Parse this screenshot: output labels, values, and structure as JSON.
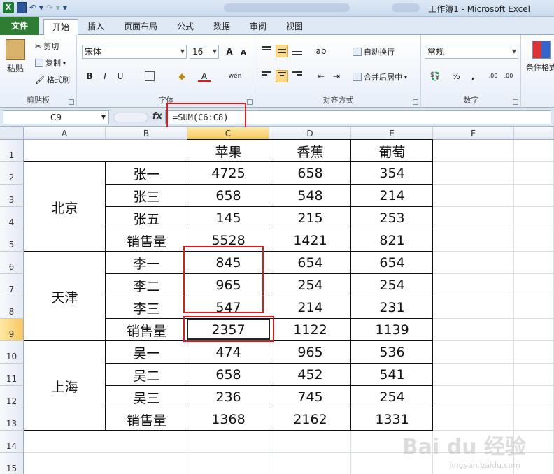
{
  "title_bar": {
    "window_title": "工作簿1 - Microsoft Excel",
    "app_icon_letter": "X"
  },
  "ribbon_tabs": [
    "文件",
    "开始",
    "插入",
    "页面布局",
    "公式",
    "数据",
    "审阅",
    "视图"
  ],
  "clipboard": {
    "paste": "粘贴",
    "cut": "剪切",
    "copy": "复制",
    "format_painter": "格式刷",
    "label": "剪贴板"
  },
  "font": {
    "name": "宋体",
    "size": "16",
    "bold": "B",
    "italic": "I",
    "underline": "U",
    "grow": "A",
    "shrink": "A",
    "color_letter": "A",
    "phonetic": "wén",
    "label": "字体"
  },
  "alignment": {
    "wrap_text": "自动换行",
    "merge_center": "合并后居中",
    "label": "对齐方式"
  },
  "number": {
    "format": "常规",
    "percent": "%",
    "comma": ",",
    "inc_dec": ".00",
    "label": "数字"
  },
  "styles": {
    "conditional_format": "条件格式"
  },
  "formula_bar": {
    "name_box": "C9",
    "fx": "fx",
    "formula": "=SUM(C6:C8)"
  },
  "columns": [
    "A",
    "B",
    "C",
    "D",
    "E",
    "F"
  ],
  "rows": [
    "1",
    "2",
    "3",
    "4",
    "5",
    "6",
    "7",
    "8",
    "9",
    "10",
    "11",
    "12",
    "13",
    "14",
    "15"
  ],
  "table": {
    "headers": [
      "苹果",
      "香蕉",
      "葡萄"
    ],
    "groups": [
      {
        "city": "北京",
        "rows": [
          {
            "name": "张一",
            "values": [
              "4725",
              "658",
              "354"
            ]
          },
          {
            "name": "张三",
            "values": [
              "658",
              "548",
              "214"
            ]
          },
          {
            "name": "张五",
            "values": [
              "145",
              "215",
              "253"
            ]
          },
          {
            "name": "销售量",
            "values": [
              "5528",
              "1421",
              "821"
            ]
          }
        ]
      },
      {
        "city": "天津",
        "rows": [
          {
            "name": "李一",
            "values": [
              "845",
              "654",
              "654"
            ]
          },
          {
            "name": "李二",
            "values": [
              "965",
              "254",
              "254"
            ]
          },
          {
            "name": "李三",
            "values": [
              "547",
              "214",
              "231"
            ]
          },
          {
            "name": "销售量",
            "values": [
              "2357",
              "1122",
              "1139"
            ]
          }
        ]
      },
      {
        "city": "上海",
        "rows": [
          {
            "name": "吴一",
            "values": [
              "474",
              "965",
              "536"
            ]
          },
          {
            "name": "吴二",
            "values": [
              "658",
              "452",
              "541"
            ]
          },
          {
            "name": "吴三",
            "values": [
              "236",
              "745",
              "254"
            ]
          },
          {
            "name": "销售量",
            "values": [
              "1368",
              "2162",
              "1331"
            ]
          }
        ]
      }
    ]
  },
  "watermark": {
    "brand": "Bai du 经验",
    "url": "jingyan.baidu.com"
  },
  "colors": {
    "file_tab": "#2e7d32",
    "highlight": "#e0191d",
    "active_header": "#f7c85e"
  }
}
